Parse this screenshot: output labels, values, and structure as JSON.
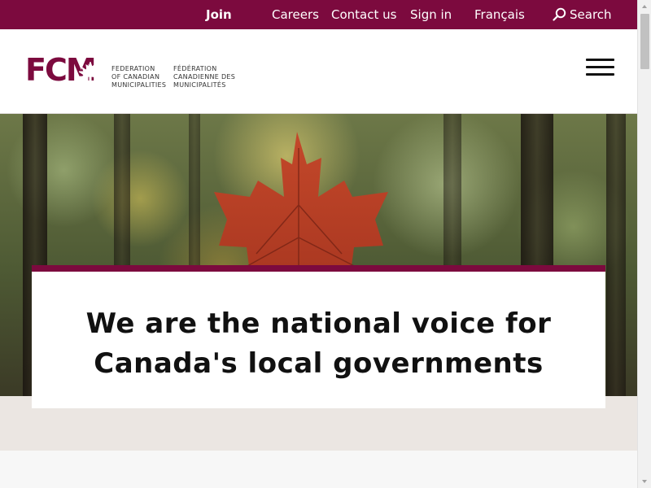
{
  "utility_nav": {
    "join": "Join",
    "careers": "Careers",
    "contact": "Contact us",
    "sign_in": "Sign in",
    "language": "Français",
    "search": "Search",
    "search_icon": "search-icon"
  },
  "header": {
    "logo_mark": "FCM",
    "logo_en": [
      "FEDERATION",
      "OF CANADIAN",
      "MUNICIPALITIES"
    ],
    "logo_fr": [
      "FÉDÉRATION",
      "CANADIENNE DES",
      "MUNICIPALITÉS"
    ],
    "menu_icon": "hamburger-menu-icon"
  },
  "hero": {
    "title_line1": "We are the national voice for",
    "title_line2": "Canada's local governments",
    "image": "maple-leaf-forest-photo"
  },
  "colors": {
    "brand": "#7c0a3e",
    "band": "#ebe6e2",
    "background": "#f7f7f7"
  }
}
